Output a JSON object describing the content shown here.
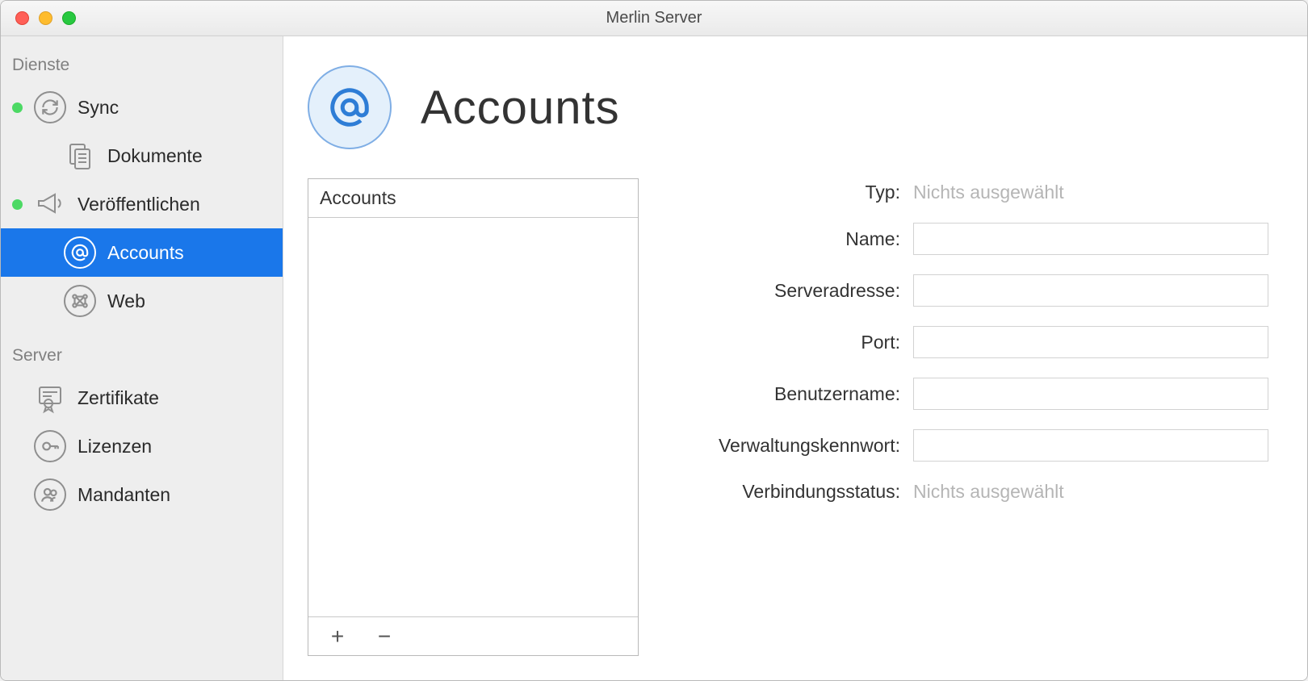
{
  "window": {
    "title": "Merlin Server"
  },
  "sidebar": {
    "sections": [
      {
        "label": "Dienste",
        "items": [
          {
            "label": "Sync",
            "status": "on"
          },
          {
            "label": "Dokumente",
            "child": true
          },
          {
            "label": "Veröffentlichen",
            "status": "on"
          },
          {
            "label": "Accounts",
            "child": true,
            "selected": true
          },
          {
            "label": "Web",
            "child": true
          }
        ]
      },
      {
        "label": "Server",
        "items": [
          {
            "label": "Zertifikate"
          },
          {
            "label": "Lizenzen"
          },
          {
            "label": "Mandanten"
          }
        ]
      }
    ]
  },
  "main": {
    "title": "Accounts",
    "listHeader": "Accounts"
  },
  "form": {
    "labels": {
      "type": "Typ:",
      "name": "Name:",
      "server": "Serveradresse:",
      "port": "Port:",
      "user": "Benutzername:",
      "password": "Verwaltungskennwort:",
      "connection": "Verbindungsstatus:"
    },
    "values": {
      "type": "Nichts ausgewählt",
      "name": "",
      "server": "",
      "port": "",
      "user": "",
      "password": "",
      "connection": "Nichts ausgewählt"
    }
  }
}
